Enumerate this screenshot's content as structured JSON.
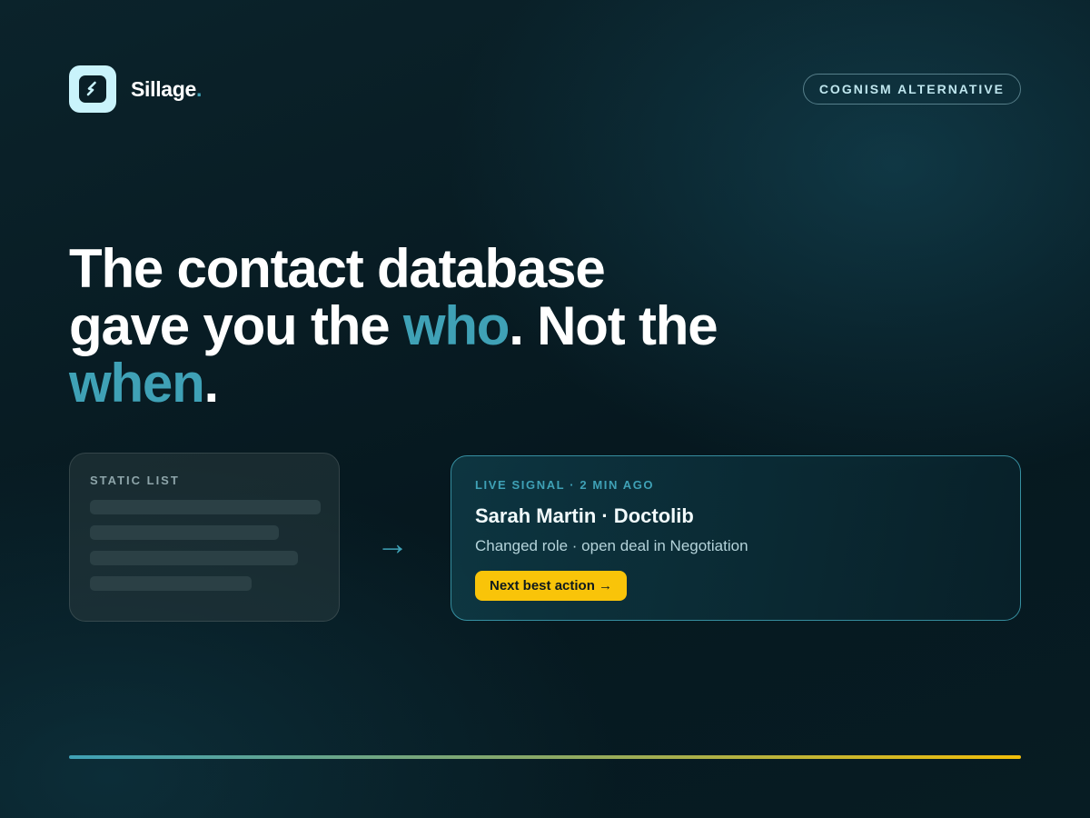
{
  "brand": {
    "name": "Sillage",
    "dot": ".",
    "logo_icon": "s-link-logo-icon"
  },
  "badge": {
    "label": "COGNISM ALTERNATIVE"
  },
  "headline": {
    "part1": "The contact database gave you the ",
    "accent1": "who",
    "part2": ". Not the ",
    "accent2": "when",
    "part3": "."
  },
  "static_card": {
    "label": "STATIC LIST",
    "placeholder_rows": 4
  },
  "arrow": {
    "glyph": "→",
    "icon": "arrow-right-icon"
  },
  "live_card": {
    "label": "LIVE SIGNAL · 2 MIN AGO",
    "title": "Sarah Martin · Doctolib",
    "subtitle": "Changed role · open deal in Negotiation",
    "action_label": "Next best action →"
  },
  "colors": {
    "accent": "#3fa1b6",
    "action": "#f9c409",
    "background": "#06181f",
    "logo_bg": "#c9f3fb"
  }
}
